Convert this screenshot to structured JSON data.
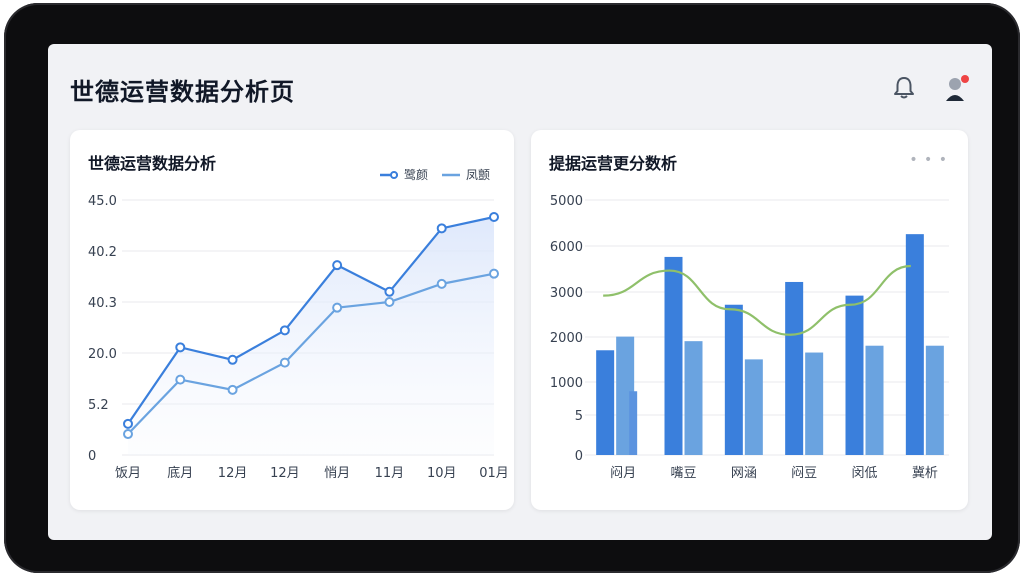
{
  "page": {
    "title": "世德运营数据分析页"
  },
  "colors": {
    "primary_blue": "#3a7fdc",
    "secondary_blue": "#6aa3e0",
    "line_green": "#8fc06a",
    "grid": "#e8eaee"
  },
  "header_icons": [
    "bell-icon",
    "avatar-icon"
  ],
  "chart_data": [
    {
      "type": "line",
      "title": "世德运营数据分析",
      "categories": [
        "饭月",
        "底月",
        "12月",
        "12月",
        "悄月",
        "11月",
        "10月",
        "01月"
      ],
      "y_tick_labels": [
        "45.0",
        "40.2",
        "40.3",
        "20.0",
        "5.2",
        "0"
      ],
      "series": [
        {
          "name": "鹭颜",
          "values": [
            5.5,
            19.0,
            16.8,
            22.0,
            33.5,
            28.8,
            40.0,
            42.0
          ]
        },
        {
          "name": "凤颤",
          "values": [
            3.7,
            13.3,
            11.5,
            16.3,
            26.0,
            27.0,
            30.2,
            32.0
          ]
        }
      ],
      "ylim": [
        0,
        45
      ],
      "legend": "top-right",
      "grid": true
    },
    {
      "type": "bar",
      "title": "提据运营更分数析",
      "categories": [
        "闷月",
        "嘴豆",
        "网涵",
        "闷豆",
        "闵低",
        "冀析"
      ],
      "y_tick_labels": [
        "5000",
        "6000",
        "3000",
        "2000",
        "1000",
        "5",
        "0"
      ],
      "series": [
        {
          "values": [
            2300,
            4350,
            3300,
            3800,
            3500,
            4850
          ]
        },
        {
          "values": [
            2600,
            2500,
            2100,
            2250,
            2400,
            2400
          ]
        },
        {
          "values": [
            1400,
            null,
            null,
            null,
            null,
            null
          ]
        },
        {
          "type": "line",
          "values": [
            3500,
            4050,
            3200,
            2640,
            3300,
            4150
          ]
        }
      ],
      "ylim": [
        0,
        5600
      ],
      "grid": true
    }
  ]
}
